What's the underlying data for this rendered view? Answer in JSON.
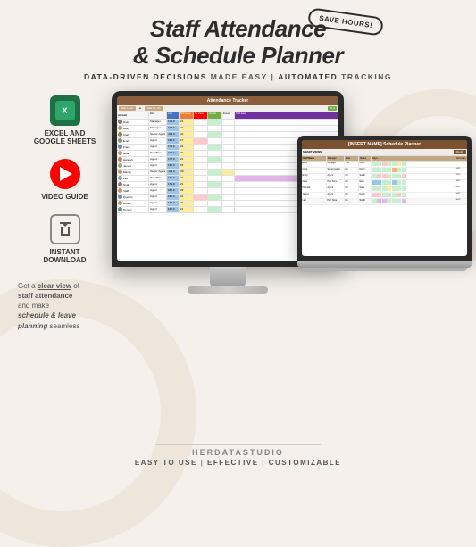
{
  "page": {
    "title": "Staff Attendance & Schedule Planner",
    "subtitle": "DATA-DRIVEN DECISIONS MADE EASY | AUTOMATED TRACKING",
    "save_badge": "SAVE HOURS!",
    "background_color": "#f5f0eb"
  },
  "features": [
    {
      "id": "excel-sheets",
      "icon": "excel-icon",
      "label": "EXCEL AND\nGOOGLE SHEETS"
    },
    {
      "id": "video-guide",
      "icon": "youtube-icon",
      "label": "VIDEO GUIDE"
    },
    {
      "id": "instant-download",
      "icon": "download-icon",
      "label": "INSTANT\nDOWNLOAD"
    }
  ],
  "description": {
    "text1": "Get a",
    "highlight1": "clear view",
    "text2": "of",
    "text3": "staff attendance",
    "text4": "and make",
    "bold_italic1": "schedule & leave",
    "text5": "planning",
    "bold_italic2": "seamless"
  },
  "main_screen": {
    "title": "Attendance Tracker",
    "columns": [
      "Name",
      "Role",
      "Late",
      "Sick leave",
      "No show",
      "Annual leave",
      "Excuse",
      "Paid Leave"
    ],
    "rows": [
      {
        "name": "Andy",
        "role": "Manager",
        "late": "179",
        "sick": "21"
      },
      {
        "name": "Betty",
        "role": "Manager",
        "late": "178",
        "sick": "21"
      },
      {
        "name": "Clark",
        "role": "Senior Agent",
        "late": "180",
        "sick": "21"
      },
      {
        "name": "Emily",
        "role": "Agent",
        "late": "144",
        "sick": "17"
      },
      {
        "name": "Frank",
        "role": "Agent",
        "late": "179",
        "sick": "21"
      },
      {
        "name": "Gina",
        "role": "Part Time",
        "late": "170",
        "sick": "21"
      },
      {
        "name": "Hannah",
        "role": "Agent",
        "late": "177",
        "sick": "21"
      },
      {
        "name": "James",
        "role": "Agent",
        "late": "165",
        "sick": "15"
      },
      {
        "name": "Manny",
        "role": "Senior Agent",
        "late": "179",
        "sick": "29"
      },
      {
        "name": "Lad",
        "role": "Part Time",
        "late": "179",
        "sick": "21"
      },
      {
        "name": "Noah",
        "role": "Agent",
        "late": "179",
        "sick": "21"
      },
      {
        "name": "Staff",
        "role": "Agent",
        "late": "187",
        "sick": "33"
      },
      {
        "name": "Quentin",
        "role": "Agent",
        "late": "181",
        "sick": "21"
      },
      {
        "name": "Robert",
        "role": "Agent",
        "late": "173",
        "sick": "21"
      },
      {
        "name": "Tommy",
        "role": "Agent",
        "late": "167",
        "sick": "21"
      }
    ]
  },
  "schedule_screen": {
    "title": "[INSERT NAME] Schedule Planner",
    "sub_title": "Month"
  },
  "footer": {
    "brand": "HERDATASTUDIO",
    "tagline": "EASY TO USE | EFFECTIVE | CUSTOMIZABLE"
  },
  "detected_text": {
    "schedule_leave": "schedule = leave"
  }
}
